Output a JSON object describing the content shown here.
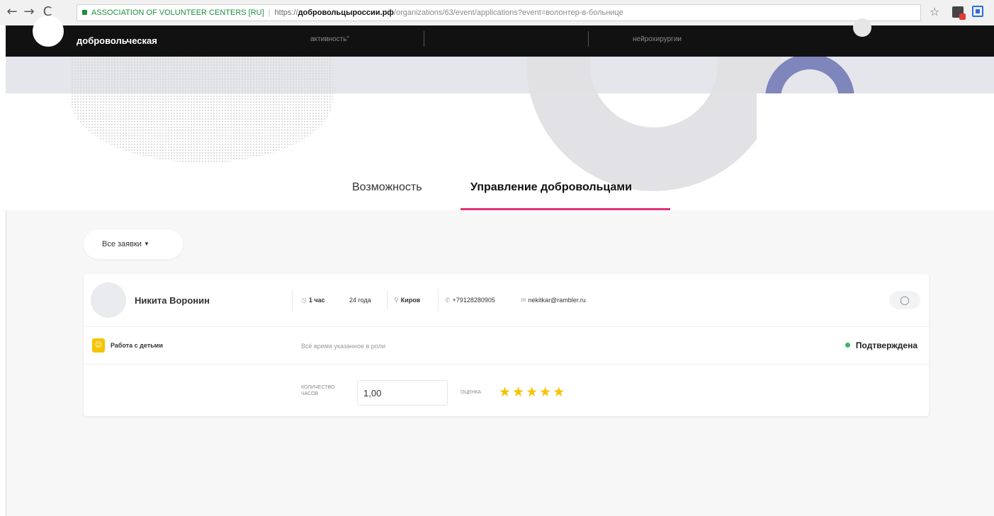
{
  "browser": {
    "back_icon": "←",
    "forward_icon": "→",
    "reload_icon": "C",
    "site_name": "ASSOCIATION OF VOLUNTEER CENTERS [RU]",
    "url_scheme": "https://",
    "url_host": "добровольцыроссии.рф",
    "url_path": "/organizations/63/event/applications?event=волонтер-в-больнице",
    "star_icon": "☆"
  },
  "site_header": {
    "brand": "добровольческая",
    "link_activity": "активность\"",
    "link_neuro": "нейрохирургии"
  },
  "tabs": {
    "opportunity": "Возможность",
    "manage": "Управление добровольцами"
  },
  "filter": {
    "label": "Все заявки",
    "caret": "▼"
  },
  "application": {
    "name": "Никита Воронин",
    "hours_icon": "◷",
    "hours": "1 час",
    "age": "24 года",
    "location_icon": "⚲",
    "city": "Киров",
    "phone_icon": "✆",
    "phone": "+79128280905",
    "email_icon": "✉",
    "email": "nekitkar@rambler.ru",
    "chat_icon": "◯",
    "role_icon": "☺",
    "role": "Работа с детьми",
    "time_note": "Всё время указанное в роли",
    "status": "Подтверждена",
    "hours_label": "Количество часов",
    "hours_value": "1,00",
    "rating_label": "Оценка",
    "star_glyph": "★",
    "rating": 5
  },
  "colors": {
    "accent_tab": "#e3317d",
    "status_ok": "#3cb55e",
    "star": "#f5c400",
    "hero_arc": "#7f86bb",
    "header_bg": "#111111"
  }
}
